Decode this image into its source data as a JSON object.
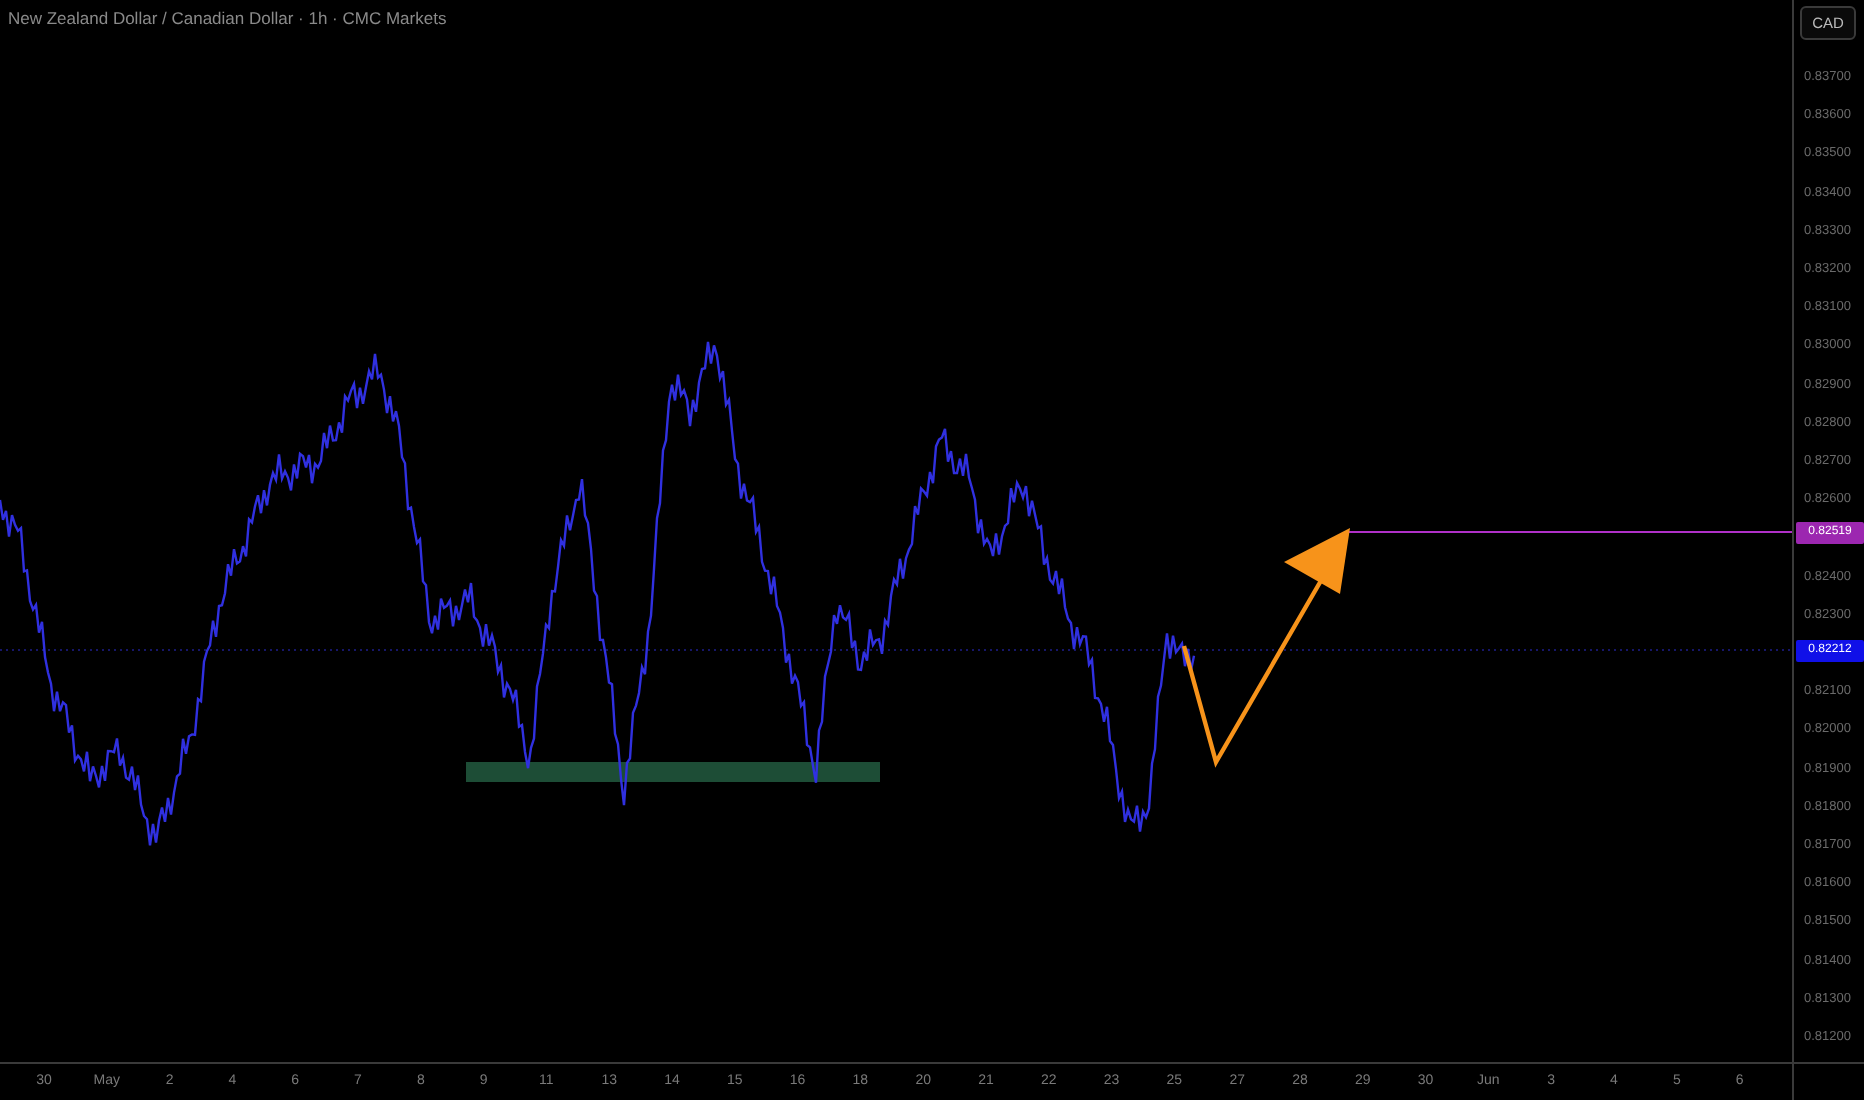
{
  "title": "New Zealand Dollar / Canadian Dollar · 1h · CMC Markets",
  "currency_button": "CAD",
  "price_axis": {
    "ticks": [
      "0.83700",
      "0.83600",
      "0.83500",
      "0.83400",
      "0.83300",
      "0.83200",
      "0.83100",
      "0.83000",
      "0.82900",
      "0.82800",
      "0.82700",
      "0.82600",
      "0.82400",
      "0.82300",
      "0.82100",
      "0.82000",
      "0.81900",
      "0.81800",
      "0.81700",
      "0.81600",
      "0.81500",
      "0.81400",
      "0.81300",
      "0.81200"
    ],
    "badges": [
      {
        "kind": "target",
        "text": "0.82519",
        "color": "#9c27b0"
      },
      {
        "kind": "current",
        "text": "0.82212",
        "color": "#1010e8"
      }
    ]
  },
  "time_axis": [
    "30",
    "May",
    "2",
    "4",
    "6",
    "7",
    "8",
    "9",
    "11",
    "13",
    "14",
    "15",
    "16",
    "18",
    "20",
    "21",
    "22",
    "23",
    "25",
    "27",
    "28",
    "29",
    "30",
    "Jun",
    "3",
    "4",
    "5",
    "6"
  ]
}
